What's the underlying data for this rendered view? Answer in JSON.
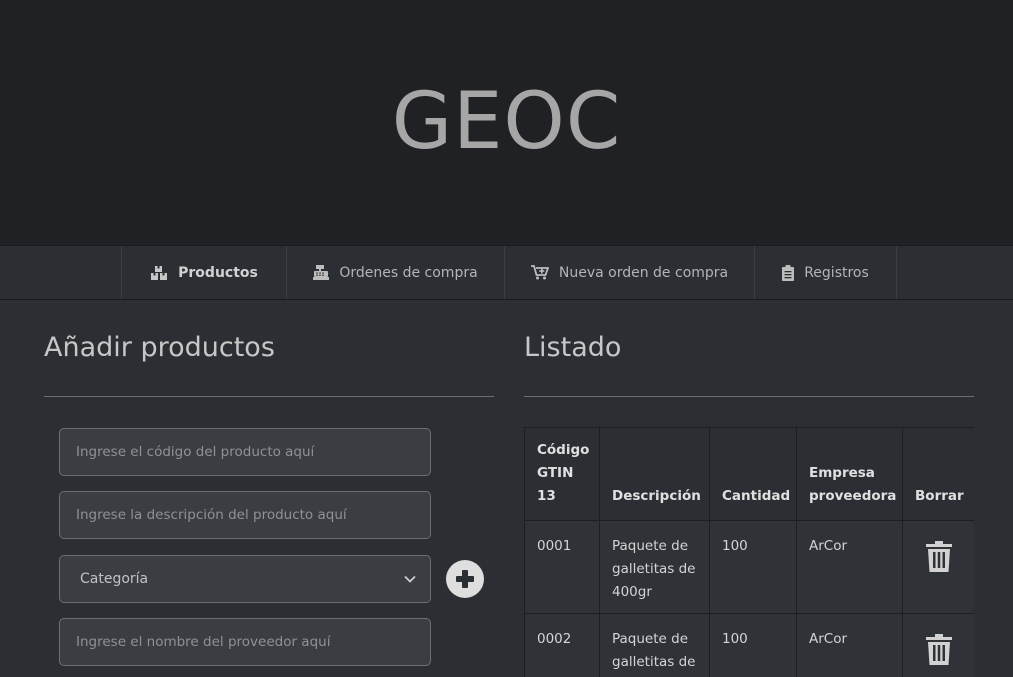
{
  "header": {
    "brand": "GEOC"
  },
  "nav": {
    "items": [
      {
        "label": "Productos",
        "icon": "boxes-icon",
        "active": true
      },
      {
        "label": "Ordenes de compra",
        "icon": "cash-register-icon",
        "active": false
      },
      {
        "label": "Nueva orden de compra",
        "icon": "cart-plus-icon",
        "active": false
      },
      {
        "label": "Registros",
        "icon": "clipboard-list-icon",
        "active": false
      }
    ]
  },
  "add_products": {
    "title": "Añadir productos",
    "code_placeholder": "Ingrese el código del producto aquí",
    "description_placeholder": "Ingrese la descripción del producto aquí",
    "category_selected": "Categoría",
    "supplier_placeholder": "Ingrese el nombre del proveedor aquí",
    "add_icon": "plus-circle-icon"
  },
  "listing": {
    "title": "Listado",
    "columns": [
      "Código GTIN 13",
      "Descripción",
      "Cantidad",
      "Empresa proveedora",
      "Borrar"
    ],
    "rows": [
      {
        "code": "0001",
        "description": "Paquete de galletitas de 400gr",
        "quantity": "100",
        "supplier": "ArCor"
      },
      {
        "code": "0002",
        "description": "Paquete de galletitas de",
        "quantity": "100",
        "supplier": "ArCor"
      }
    ],
    "delete_icon": "trash-icon"
  },
  "colors": {
    "header_bg": "#202125",
    "page_bg": "#2b2e33",
    "input_bg": "#3a3e43"
  }
}
